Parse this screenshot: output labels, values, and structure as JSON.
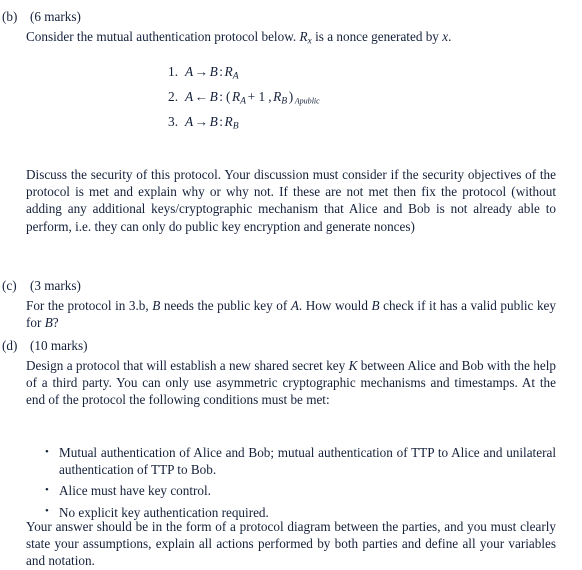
{
  "document": {
    "type": "exam-question-page",
    "text_color": "#14203a",
    "background_color": "#ffffff"
  },
  "questions": [
    {
      "label": "(b)",
      "marks": "(6 marks)",
      "intro_pre": "Consider the mutual authentication protocol below. ",
      "intro_math_base": "R",
      "intro_math_sub": "x",
      "intro_post": " is a nonce generated by ",
      "intro_var": "x",
      "intro_end": ".",
      "protocol": {
        "steps": [
          {
            "number": "1.",
            "sender": "A",
            "arrow": "→",
            "receiver": "B",
            "colon": ":",
            "message_base": "R",
            "message_sub": "A",
            "plain": "1. A → B : R_A"
          },
          {
            "number": "2.",
            "sender": "A",
            "arrow": "←",
            "receiver": "B",
            "colon": ":",
            "open": "(",
            "m1_base": "R",
            "m1_sub": "A",
            "m1_plus": "+ 1",
            "comma": ",",
            "m2_base": "R",
            "m2_sub": "B",
            "close": ")",
            "key_sub": "Apublic",
            "plain": "2. A ← B : (R_A + 1, R_B)_{A public}"
          },
          {
            "number": "3.",
            "sender": "A",
            "arrow": "→",
            "receiver": "B",
            "colon": ":",
            "message_base": "R",
            "message_sub": "B",
            "plain": "3. A → B : R_B"
          }
        ]
      },
      "body": "Discuss the security of this protocol. Your discussion must consider if the security objectives of the protocol is met and explain why or why not. If these are not met then fix the protocol (without adding any additional keys/cryptographic mechanism that Alice and Bob is not already able to perform, i.e. they can only do public key encryption and generate nonces)"
    },
    {
      "label": "(c)",
      "marks": "(3 marks)",
      "body_p1": "For the protocol in 3.b, ",
      "body_v1": "B",
      "body_p2": " needs the public key of ",
      "body_v2": "A",
      "body_p3": ". How would ",
      "body_v3": "B",
      "body_p4": " check if it has a valid public key for ",
      "body_v4": "B",
      "body_p5": "?"
    },
    {
      "label": "(d)",
      "marks": "(10 marks)",
      "body_p1": "Design a protocol that will establish a new shared secret key ",
      "body_var": "K",
      "body_p2": " between Alice and Bob with the help of a third party. You can only use asymmetric cryptographic mechanisms and timestamps. At the end of the protocol the following conditions must be met:",
      "conditions": [
        "Mutual authentication of Alice and Bob; mutual authentication of TTP to Alice and unilateral authentication of TTP to Bob.",
        "Alice must have key control.",
        "No explicit key authentication required."
      ],
      "closing": "Your answer should be in the form of a protocol diagram between the parties, and you must clearly state your assumptions, explain all actions performed by both parties and define all your variables and notation."
    }
  ]
}
